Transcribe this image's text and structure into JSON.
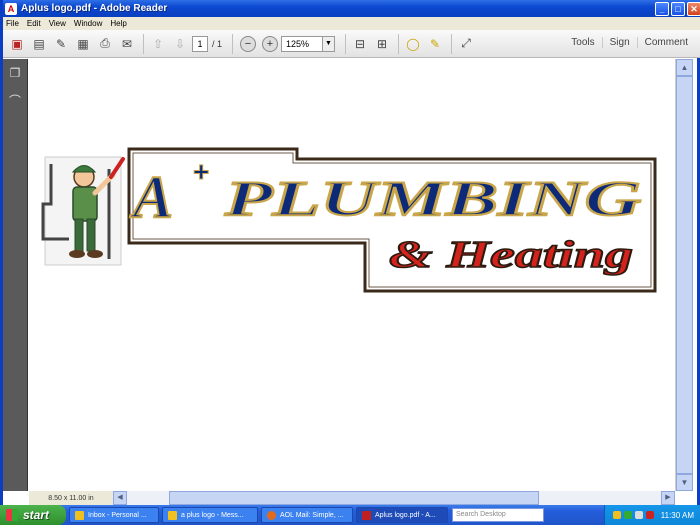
{
  "window": {
    "title": "Aplus logo.pdf - Adobe Reader",
    "buttons": [
      "_",
      "□",
      "✕"
    ]
  },
  "menu": [
    "File",
    "Edit",
    "View",
    "Window",
    "Help"
  ],
  "toolbar": {
    "page_current": "1",
    "page_total": "/ 1",
    "zoom": "125%",
    "right_links": [
      "Tools",
      "Sign",
      "Comment"
    ]
  },
  "document": {
    "logo_line1_a": "A",
    "logo_line1_sup": "+",
    "logo_line1_rest": "PLUMBING",
    "logo_line2": "& Heating"
  },
  "statusbar": {
    "page_size": "8.50 x 11.00 in"
  },
  "taskbar": {
    "start": "start",
    "tasks": [
      {
        "label": "Inbox - Personal ...",
        "color": "#f0c020"
      },
      {
        "label": "a plus logo - Mess...",
        "color": "#f0c020"
      },
      {
        "label": "AOL Mail: Simple, ...",
        "color": "#e26a1a"
      },
      {
        "label": "Aplus logo.pdf - A...",
        "color": "#c02020"
      }
    ],
    "search_placeholder": "Search Desktop",
    "clock": "11:30 AM"
  },
  "colors": {
    "logo_blue": "#0d2a78",
    "logo_red": "#d4231c",
    "logo_outline": "#3b2a1a"
  }
}
